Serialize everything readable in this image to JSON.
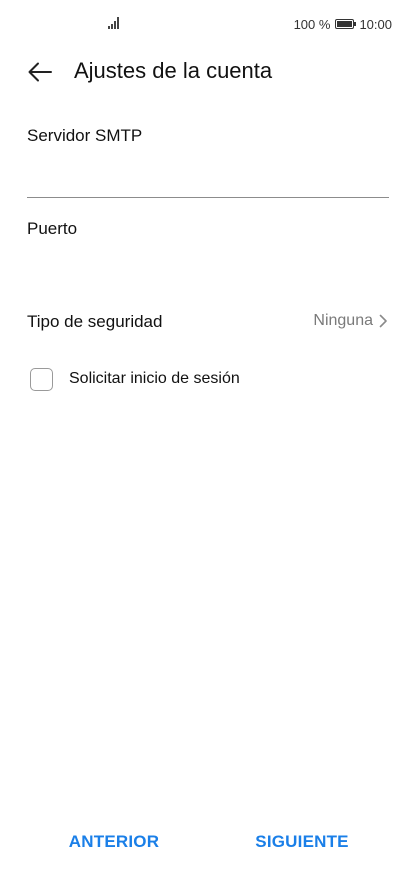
{
  "status_bar": {
    "battery_percent": "100 %",
    "time": "10:00"
  },
  "header": {
    "title": "Ajustes de la cuenta"
  },
  "form": {
    "smtp_label": "Servidor SMTP",
    "smtp_value": "",
    "port_label": "Puerto",
    "port_value": "",
    "security_label": "Tipo de seguridad",
    "security_value": "Ninguna",
    "login_label": "Solicitar inicio de sesión",
    "login_checked": false
  },
  "footer": {
    "prev_label": "ANTERIOR",
    "next_label": "SIGUIENTE"
  },
  "colors": {
    "accent": "#1a7fe8",
    "secondary_text": "#7a7a7a"
  },
  "icons": [
    "signal-icon",
    "battery-icon",
    "back-arrow-icon",
    "chevron-right-icon"
  ]
}
